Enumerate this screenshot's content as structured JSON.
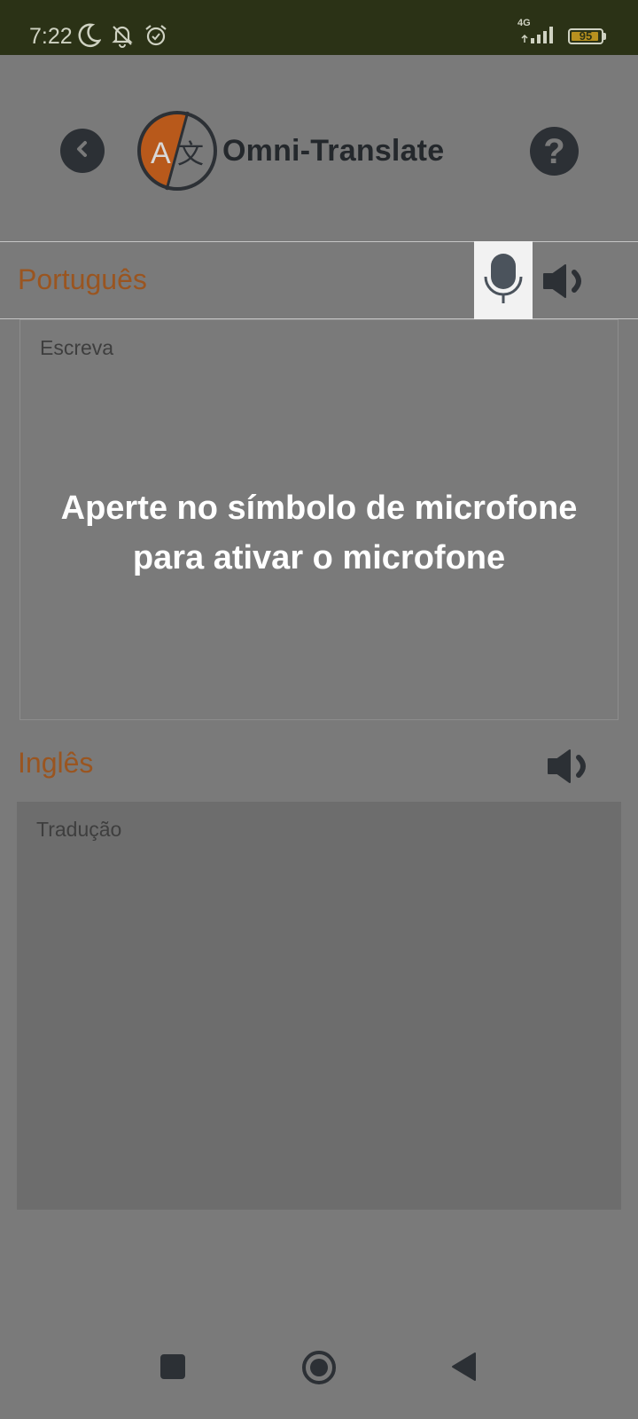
{
  "status_bar": {
    "time": "7:22",
    "network": "4G",
    "battery": "95",
    "battery_level": 0.95,
    "icons": [
      "moon-icon",
      "bell-off-icon",
      "alarm-icon",
      "signal-icon",
      "battery-icon"
    ]
  },
  "header": {
    "app_title": "Omni-Translate",
    "logo_letters": [
      "A",
      "文"
    ],
    "help_label": "?"
  },
  "source": {
    "language": "Português",
    "placeholder": "Escreva"
  },
  "target": {
    "language": "Inglês",
    "placeholder": "Tradução"
  },
  "overlay": {
    "message_line1": "Aperte no símbolo de microfone",
    "message_line2": "para ativar o microfone"
  },
  "colors": {
    "accent": "#9a5520",
    "logo_orange": "#b8591b",
    "status_bar": "#2b3216",
    "dim_overlay": "#7a7a7a"
  }
}
